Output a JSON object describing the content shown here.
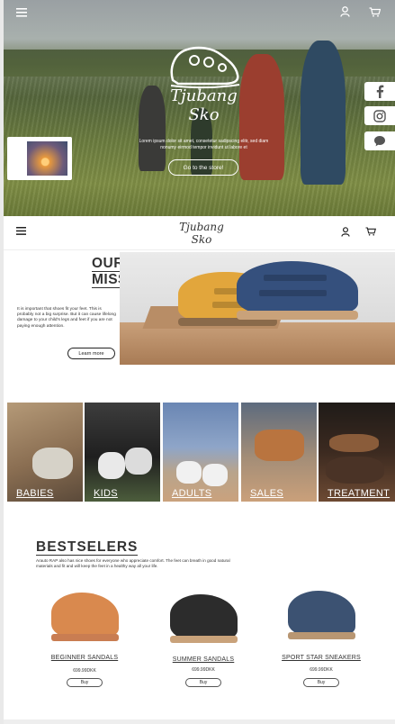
{
  "hero": {
    "brand_name": "Tjubang Sko",
    "tagline": "Lorem ipsum dolor sit amet, consetetur sadipscing elitr, sed diam nonumy eirmod tempor invidunt ut labore et",
    "cta_label": "Go to the store!"
  },
  "nav": {
    "brand_name": "Tjubang Sko"
  },
  "mission": {
    "title_line1": "OUR",
    "title_line2": "MISSION",
    "text": "It is important that shoes fit your feet. This is probably not a big surprise. But it can cause lifelong damage to your child's legs and feet if you are not paying enough attention.",
    "button_label": "Learn more"
  },
  "categories": [
    {
      "label": "BABIES"
    },
    {
      "label": "KIDS"
    },
    {
      "label": "ADULTS"
    },
    {
      "label": "SALES"
    },
    {
      "label": "TREATMENT"
    }
  ],
  "bestsellers": {
    "title": "BESTSELERS",
    "subtitle": "Arauto RAP also has nice shoes for everyone who appreciate comfort. The feet can breath in good natural materials and fit and will keep the feet in a healthy way all your life.",
    "products": [
      {
        "name": "BEGINNER SANDALS",
        "price": "699.99DKK",
        "buy_label": "Buy",
        "color": "#d9894e"
      },
      {
        "name": "SUMMER SANDALS",
        "price": "699.99DKK",
        "buy_label": "Buy",
        "color": "#2c2c2c"
      },
      {
        "name": "SPORT STAR SNEAKERS",
        "price": "699.99DKK",
        "buy_label": "Buy",
        "color": "#3c5272"
      }
    ]
  },
  "icons": {
    "menu": "menu-icon",
    "user": "user-icon",
    "cart": "cart-icon",
    "facebook": "facebook-icon",
    "instagram": "instagram-icon",
    "chat": "chat-icon",
    "play": "video-thumbnail"
  }
}
